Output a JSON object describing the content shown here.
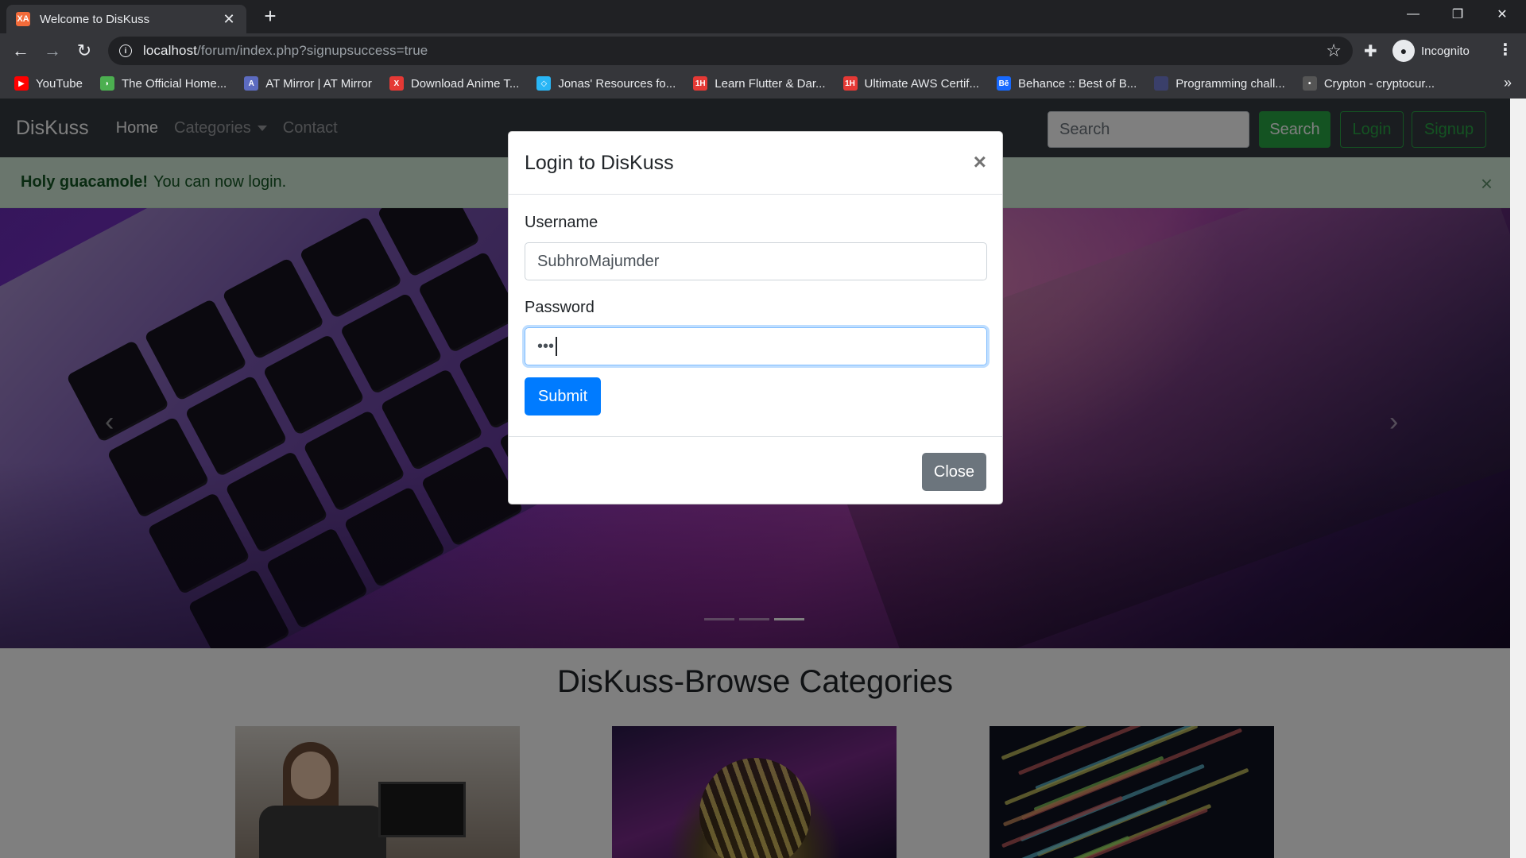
{
  "browser": {
    "tab_title": "Welcome to DisKuss",
    "tab_favicon_text": "XA",
    "new_tab_symbol": "+",
    "url_host": "localhost",
    "url_path": "/forum/index.php?signupsuccess=true",
    "profile_label": "Incognito",
    "more_bookmarks": "»",
    "bookmarks": [
      {
        "label": "YouTube",
        "icon": "youtube-icon",
        "color": "#ff0000",
        "glyph": "▶"
      },
      {
        "label": "The Official Home...",
        "icon": "leaf-icon",
        "color": "#4caf50",
        "glyph": "◗"
      },
      {
        "label": "AT Mirror | AT Mirror",
        "icon": "at-mirror-icon",
        "color": "#5c6bc0",
        "glyph": "A"
      },
      {
        "label": "Download Anime T...",
        "icon": "x-logo-icon",
        "color": "#e53935",
        "glyph": "X"
      },
      {
        "label": "Jonas' Resources fo...",
        "icon": "diamond-icon",
        "color": "#29b6f6",
        "glyph": "◇"
      },
      {
        "label": "Learn Flutter & Dar...",
        "icon": "oneh-icon",
        "color": "#e53935",
        "glyph": "1H"
      },
      {
        "label": "Ultimate AWS Certif...",
        "icon": "oneh-icon",
        "color": "#e53935",
        "glyph": "1H"
      },
      {
        "label": "Behance :: Best of B...",
        "icon": "behance-icon",
        "color": "#1769ff",
        "glyph": "Bē"
      },
      {
        "label": "Programming chall...",
        "icon": "code-challenge-icon",
        "color": "#3a3f6a",
        "glyph": ""
      },
      {
        "label": "Crypton - cryptocur...",
        "icon": "crypton-icon",
        "color": "#555555",
        "glyph": "•"
      }
    ]
  },
  "site": {
    "brand": "DisKuss",
    "nav": {
      "home": "Home",
      "categories": "Categories",
      "contact": "Contact"
    },
    "search_placeholder": "Search",
    "search_button": "Search",
    "login_button": "Login",
    "signup_button": "Signup",
    "alert": {
      "strong": "Holy guacamole!",
      "text": "You can now login.",
      "close": "×"
    },
    "carousel": {
      "prev": "‹",
      "next": "›",
      "slides": 3,
      "active_slide": 3
    },
    "section_title": "DisKuss-Browse Categories"
  },
  "modal": {
    "title": "Login to DisKuss",
    "close_x": "×",
    "username_label": "Username",
    "username_value": "SubhroMajumder",
    "password_label": "Password",
    "password_value": "•••",
    "submit": "Submit",
    "close": "Close"
  },
  "colors": {
    "navbar": "#343a40",
    "success": "#28a745",
    "primary": "#007bff",
    "secondary": "#6c757d",
    "alert_bg": "#d4edda"
  }
}
